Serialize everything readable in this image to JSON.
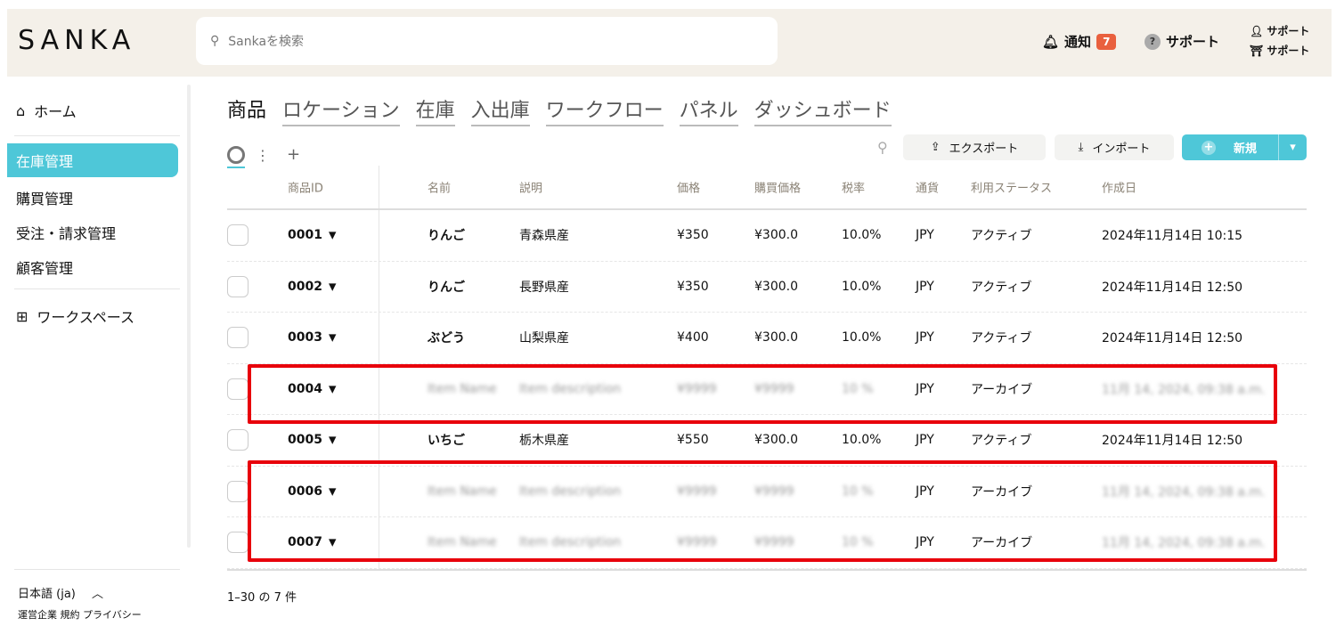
{
  "header": {
    "logo": "SANKA",
    "search_placeholder": "Sankaを検索",
    "notifications_label": "通知",
    "notifications_count": "7",
    "support_label": "サポート",
    "user_line1": "サポート",
    "user_line2": "サポート"
  },
  "sidebar": {
    "home": "ホーム",
    "items": [
      "在庫管理",
      "購買管理",
      "受注・請求管理",
      "顧客管理"
    ],
    "workspace": "ワークスペース",
    "language": "日本語 (ja)",
    "footer_links": [
      "運営企業",
      "規約",
      "プライバシー"
    ]
  },
  "tabs": [
    "商品",
    "ロケーション",
    "在庫",
    "入出庫",
    "ワークフロー",
    "パネル",
    "ダッシュボード"
  ],
  "toolbar": {
    "export": "エクスポート",
    "import": "インポート",
    "new": "新規",
    "add_view": "+"
  },
  "table": {
    "columns": [
      "商品ID",
      "名前",
      "説明",
      "価格",
      "購買価格",
      "税率",
      "通貨",
      "利用ステータス",
      "作成日"
    ],
    "rows": [
      {
        "id": "0001",
        "name": "りんご",
        "desc": "青森県産",
        "price": "¥350",
        "cost": "¥300.0",
        "tax": "10.0%",
        "cur": "JPY",
        "status": "アクティブ",
        "created": "2024年11月14日 10:15",
        "archived": false
      },
      {
        "id": "0002",
        "name": "りんご",
        "desc": "長野県産",
        "price": "¥350",
        "cost": "¥300.0",
        "tax": "10.0%",
        "cur": "JPY",
        "status": "アクティブ",
        "created": "2024年11月14日 12:50",
        "archived": false
      },
      {
        "id": "0003",
        "name": "ぶどう",
        "desc": "山梨県産",
        "price": "¥400",
        "cost": "¥300.0",
        "tax": "10.0%",
        "cur": "JPY",
        "status": "アクティブ",
        "created": "2024年11月14日 12:50",
        "archived": false
      },
      {
        "id": "0004",
        "name": "Item Name",
        "desc": "Item description",
        "price": "¥9999",
        "cost": "¥9999",
        "tax": "10 %",
        "cur": "JPY",
        "status": "アーカイブ",
        "created": "11月 14, 2024, 09:38 a.m.",
        "archived": true
      },
      {
        "id": "0005",
        "name": "いちご",
        "desc": "栃木県産",
        "price": "¥550",
        "cost": "¥300.0",
        "tax": "10.0%",
        "cur": "JPY",
        "status": "アクティブ",
        "created": "2024年11月14日 12:50",
        "archived": false
      },
      {
        "id": "0006",
        "name": "Item Name",
        "desc": "Item description",
        "price": "¥9999",
        "cost": "¥9999",
        "tax": "10 %",
        "cur": "JPY",
        "status": "アーカイブ",
        "created": "11月 14, 2024, 09:38 a.m.",
        "archived": true
      },
      {
        "id": "0007",
        "name": "Item Name",
        "desc": "Item description",
        "price": "¥9999",
        "cost": "¥9999",
        "tax": "10 %",
        "cur": "JPY",
        "status": "アーカイブ",
        "created": "11月 14, 2024, 09:38 a.m.",
        "archived": true
      }
    ]
  },
  "pagination": "1–30 の 7 件",
  "colors": {
    "accent": "#4ec7d8",
    "badge": "#e9603e",
    "highlight": "#e8000b",
    "header_bg": "#f4f0e9"
  }
}
